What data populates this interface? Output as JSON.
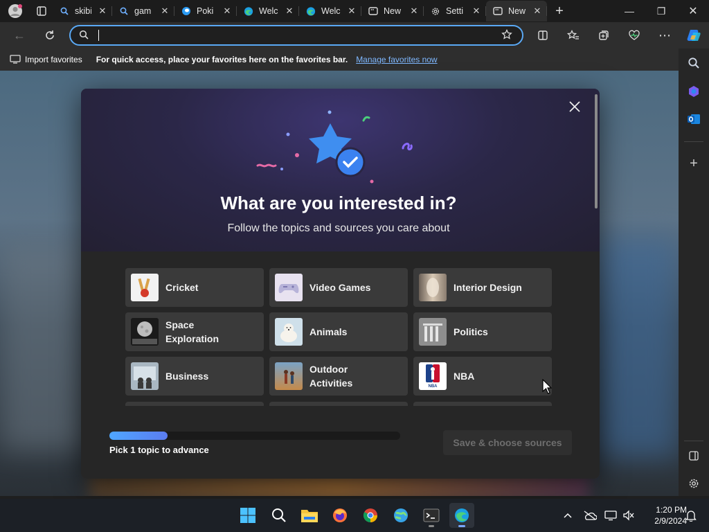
{
  "tabs": [
    {
      "label": "skibi",
      "icon": "search-icon"
    },
    {
      "label": "gam",
      "icon": "search-icon"
    },
    {
      "label": "Poki",
      "icon": "poki-icon"
    },
    {
      "label": "Welc",
      "icon": "edge-icon"
    },
    {
      "label": "Welc",
      "icon": "edge-icon"
    },
    {
      "label": "New",
      "icon": "newtab-icon"
    },
    {
      "label": "Setti",
      "icon": "gear-icon"
    },
    {
      "label": "New",
      "icon": "newtab-icon",
      "active": true
    }
  ],
  "address": {
    "value": "",
    "placeholder": ""
  },
  "favbar": {
    "import_label": "Import favorites",
    "message": "For quick access, place your favorites here on the favorites bar.",
    "manage_link": "Manage favorites now"
  },
  "modal": {
    "title": "What are you interested in?",
    "subtitle": "Follow the topics and sources you care about",
    "topics": [
      {
        "label": "Cricket",
        "icon": "cricket-thumb"
      },
      {
        "label": "Video Games",
        "icon": "gamepad-thumb"
      },
      {
        "label": "Interior Design",
        "icon": "interior-thumb"
      },
      {
        "label": "Space Exploration",
        "icon": "moon-thumb"
      },
      {
        "label": "Animals",
        "icon": "polar-bear-thumb"
      },
      {
        "label": "Politics",
        "icon": "columns-thumb"
      },
      {
        "label": "Business",
        "icon": "office-thumb"
      },
      {
        "label": "Outdoor Activities",
        "icon": "hikers-thumb"
      },
      {
        "label": "NBA",
        "icon": "nba-logo-thumb"
      }
    ],
    "progress_fraction": 0.2,
    "progress_label": "Pick 1 topic to advance",
    "save_button": "Save & choose sources"
  },
  "clock": {
    "time": "1:20 PM",
    "date": "2/9/2024"
  },
  "colors": {
    "accent": "#5aa9f5",
    "progress_start": "#4fa6ff",
    "progress_end": "#5b7cf0"
  }
}
